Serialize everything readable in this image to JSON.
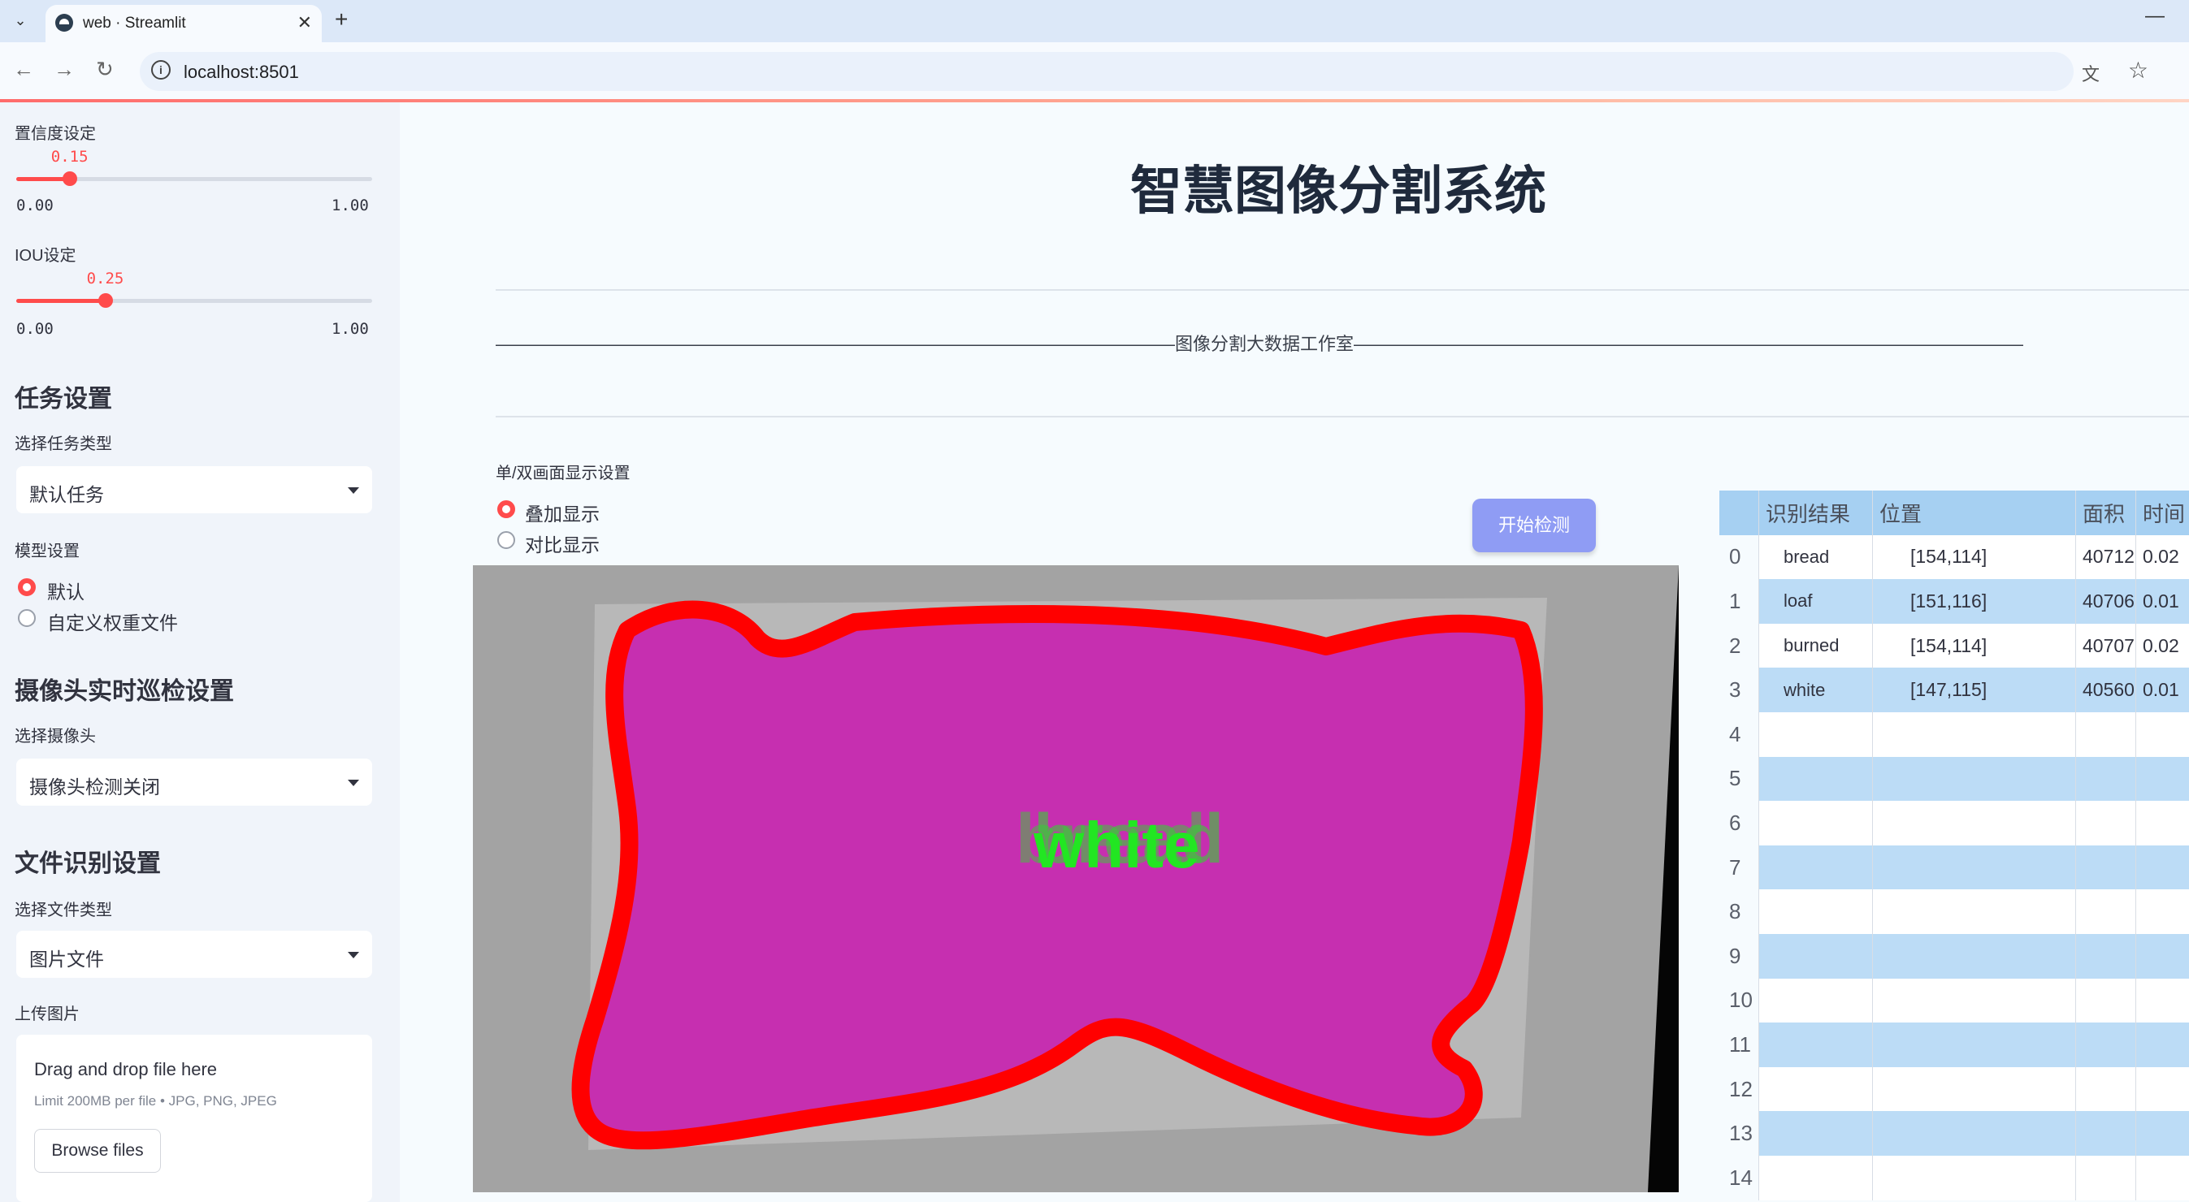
{
  "browser": {
    "tab_title": "web · Streamlit",
    "url": "localhost:8501"
  },
  "sidebar": {
    "confidence": {
      "label": "置信度设定",
      "value": "0.15",
      "min": "0.00",
      "max": "1.00",
      "fraction": 0.15
    },
    "iou": {
      "label": "IOU设定",
      "value": "0.25",
      "min": "0.00",
      "max": "1.00",
      "fraction": 0.25
    },
    "task_section": "任务设置",
    "task_type_label": "选择任务类型",
    "task_type_value": "默认任务",
    "model_label": "模型设置",
    "model_options": [
      "默认",
      "自定义权重文件"
    ],
    "model_selected": 0,
    "camera_section": "摄像头实时巡检设置",
    "camera_label": "选择摄像头",
    "camera_value": "摄像头检测关闭",
    "file_section": "文件识别设置",
    "file_type_label": "选择文件类型",
    "file_type_value": "图片文件",
    "upload_label": "上传图片",
    "upload": {
      "title": "Drag and drop file here",
      "limit": "Limit 200MB per file • JPG, PNG, JPEG",
      "button": "Browse files"
    }
  },
  "main": {
    "title": "智慧图像分割系统",
    "subtitle": "——————————————————————————————————————图像分割大数据工作室——————————————————————————————————————",
    "display_mode_label": "单/双画面显示设置",
    "display_options": [
      "叠加显示",
      "对比显示"
    ],
    "display_selected": 0,
    "detect_button": "开始检测",
    "overlay_label": "white",
    "overlay_ghost_label": "bread"
  },
  "table": {
    "headers": [
      "识别结果",
      "位置",
      "面积",
      "时间"
    ],
    "rows": [
      {
        "index": "0",
        "result": "bread",
        "position": "[154,114]",
        "area": "40712",
        "time": "0.02"
      },
      {
        "index": "1",
        "result": "loaf",
        "position": "[151,116]",
        "area": "40706",
        "time": "0.01"
      },
      {
        "index": "2",
        "result": "burned",
        "position": "[154,114]",
        "area": "40707",
        "time": "0.02"
      },
      {
        "index": "3",
        "result": "white",
        "position": "[147,115]",
        "area": "40560",
        "time": "0.01"
      },
      {
        "index": "4",
        "result": "",
        "position": "",
        "area": "",
        "time": ""
      },
      {
        "index": "5",
        "result": "",
        "position": "",
        "area": "",
        "time": ""
      },
      {
        "index": "6",
        "result": "",
        "position": "",
        "area": "",
        "time": ""
      },
      {
        "index": "7",
        "result": "",
        "position": "",
        "area": "",
        "time": ""
      },
      {
        "index": "8",
        "result": "",
        "position": "",
        "area": "",
        "time": ""
      },
      {
        "index": "9",
        "result": "",
        "position": "",
        "area": "",
        "time": ""
      },
      {
        "index": "10",
        "result": "",
        "position": "",
        "area": "",
        "time": ""
      },
      {
        "index": "11",
        "result": "",
        "position": "",
        "area": "",
        "time": ""
      },
      {
        "index": "12",
        "result": "",
        "position": "",
        "area": "",
        "time": ""
      },
      {
        "index": "13",
        "result": "",
        "position": "",
        "area": "",
        "time": ""
      },
      {
        "index": "14",
        "result": "",
        "position": "",
        "area": "",
        "time": ""
      }
    ]
  },
  "colors": {
    "accent": "#ff4b4b",
    "button": "#8f9cf4",
    "mask": "#c62fb0",
    "contour": "#ff0000",
    "label_text": "#2bdc2b"
  }
}
